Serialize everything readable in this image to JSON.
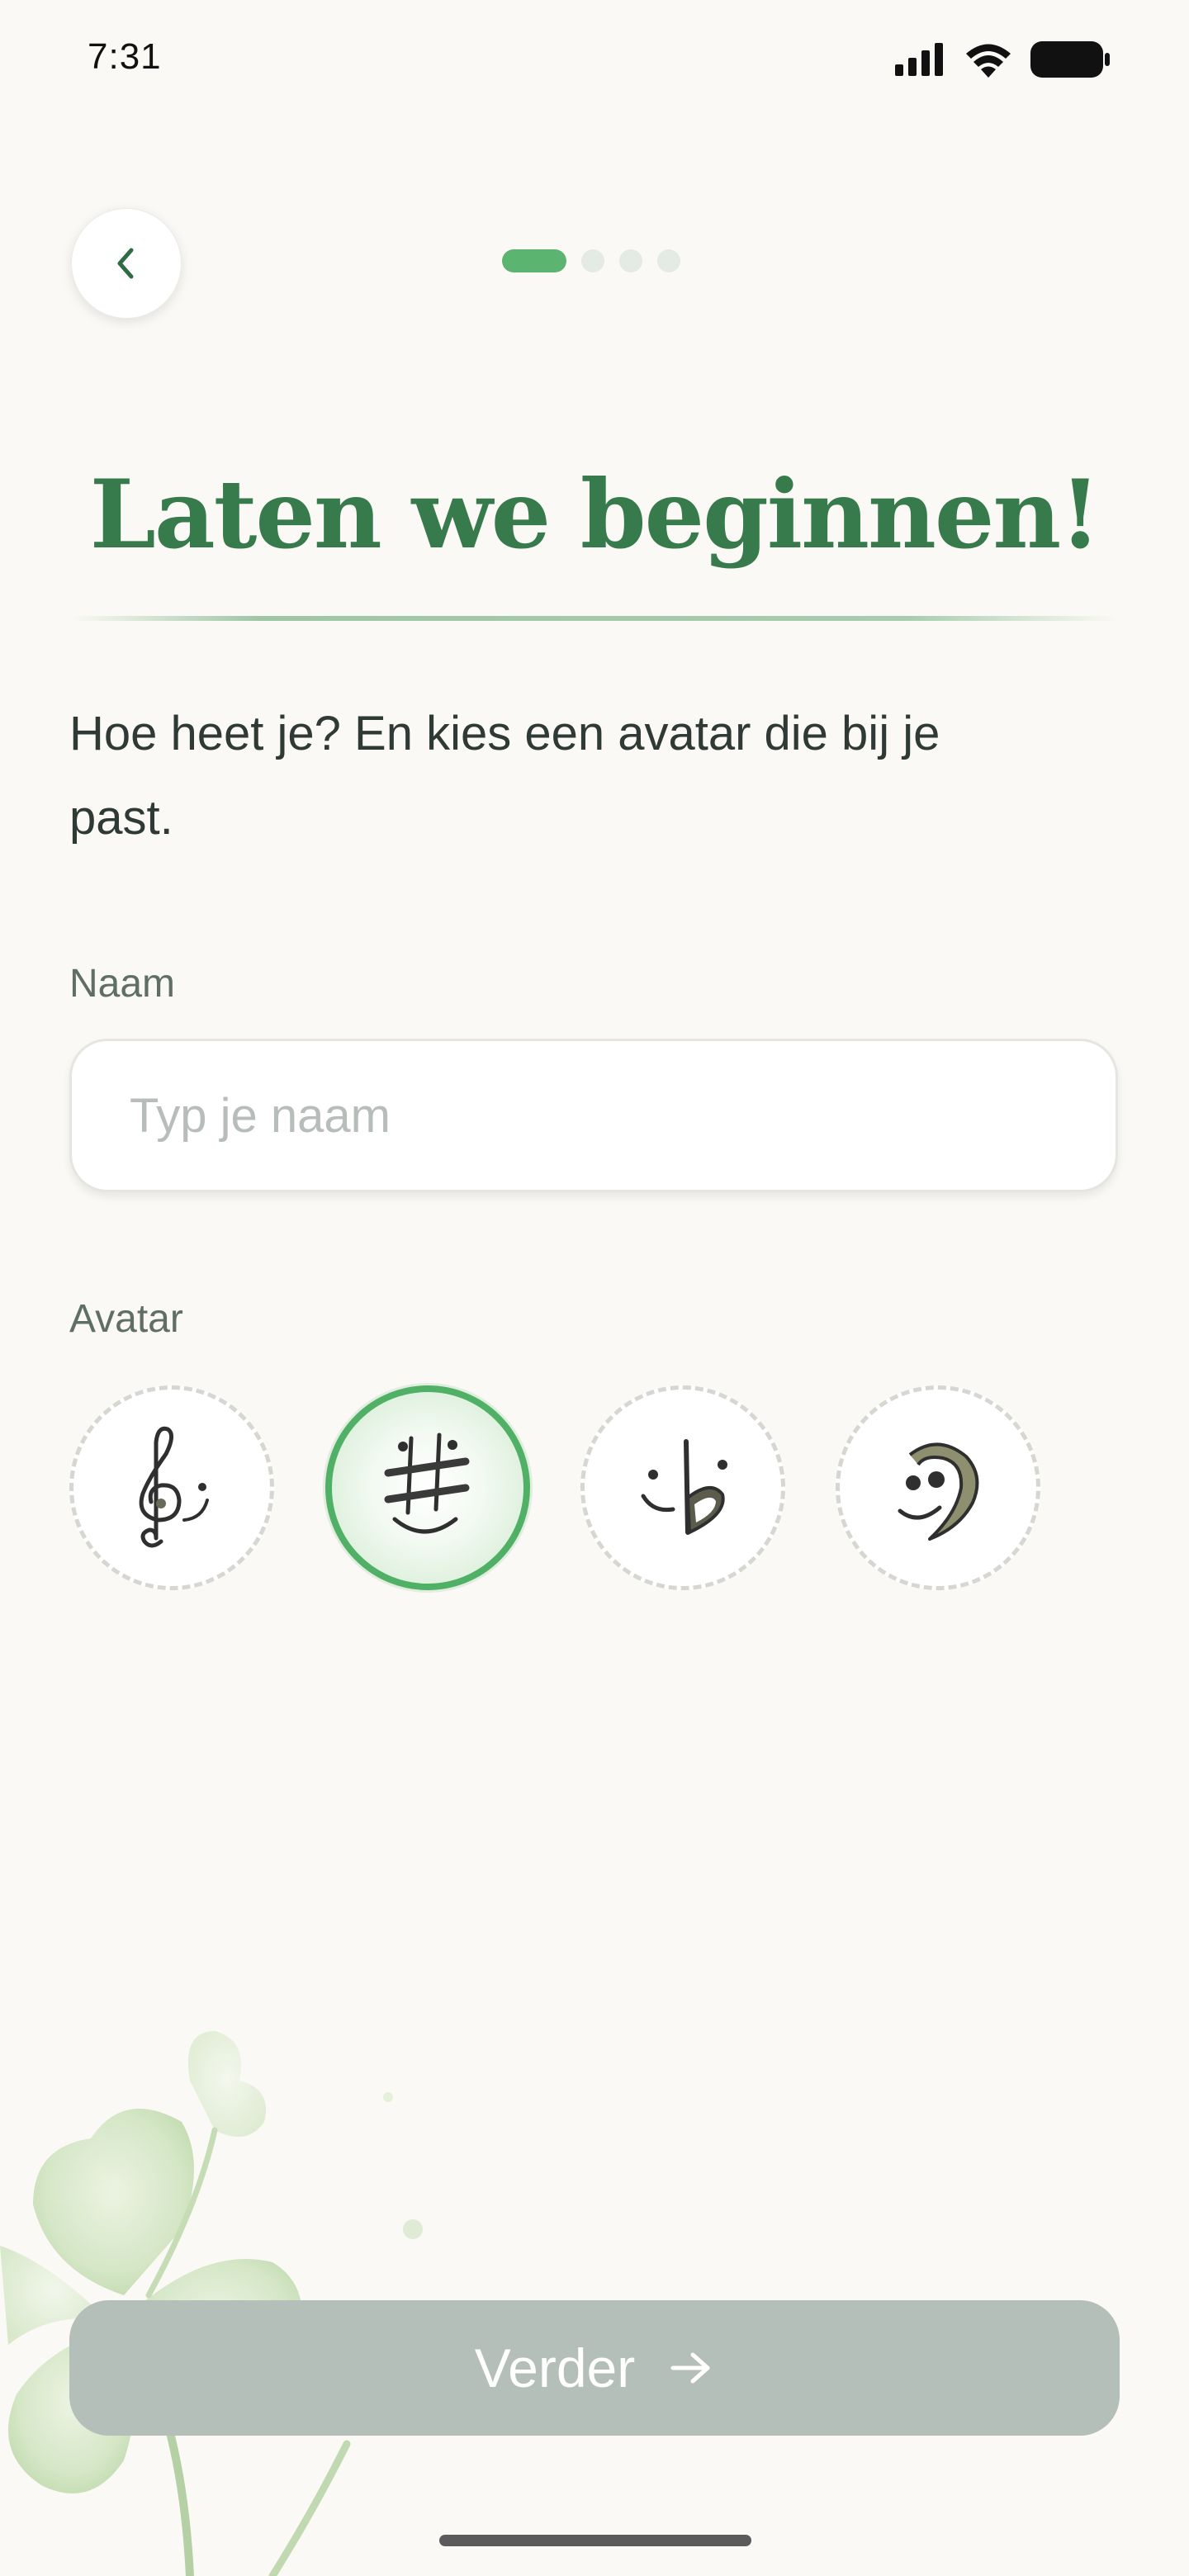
{
  "status_bar": {
    "time": "7:31",
    "icons": [
      "signal-icon",
      "wifi-icon",
      "battery-icon"
    ]
  },
  "navigation": {
    "back_icon": "chevron-left-icon",
    "progress": {
      "current_step": 1,
      "total_steps": 4
    }
  },
  "header": {
    "title": "Laten we beginnen!"
  },
  "intro": {
    "text": "Hoe heet je? En kies een avatar die bij je past."
  },
  "form": {
    "name_label": "Naam",
    "name_value": "",
    "name_placeholder": "Typ je naam",
    "avatar_label": "Avatar",
    "avatars": [
      {
        "icon": "treble-clef-face-icon",
        "selected": false
      },
      {
        "icon": "sharp-sign-face-icon",
        "selected": true
      },
      {
        "icon": "flat-sign-face-icon",
        "selected": false
      },
      {
        "icon": "bass-clef-face-icon",
        "selected": false
      }
    ]
  },
  "footer": {
    "cta_label": "Verder",
    "cta_icon": "arrow-right-icon",
    "cta_enabled": false
  },
  "colors": {
    "background": "#fbf9f5",
    "accent_green": "#377a4b",
    "progress_active": "#5cb471",
    "selected_border": "#4fb066",
    "cta_disabled": "#b5bfba"
  }
}
